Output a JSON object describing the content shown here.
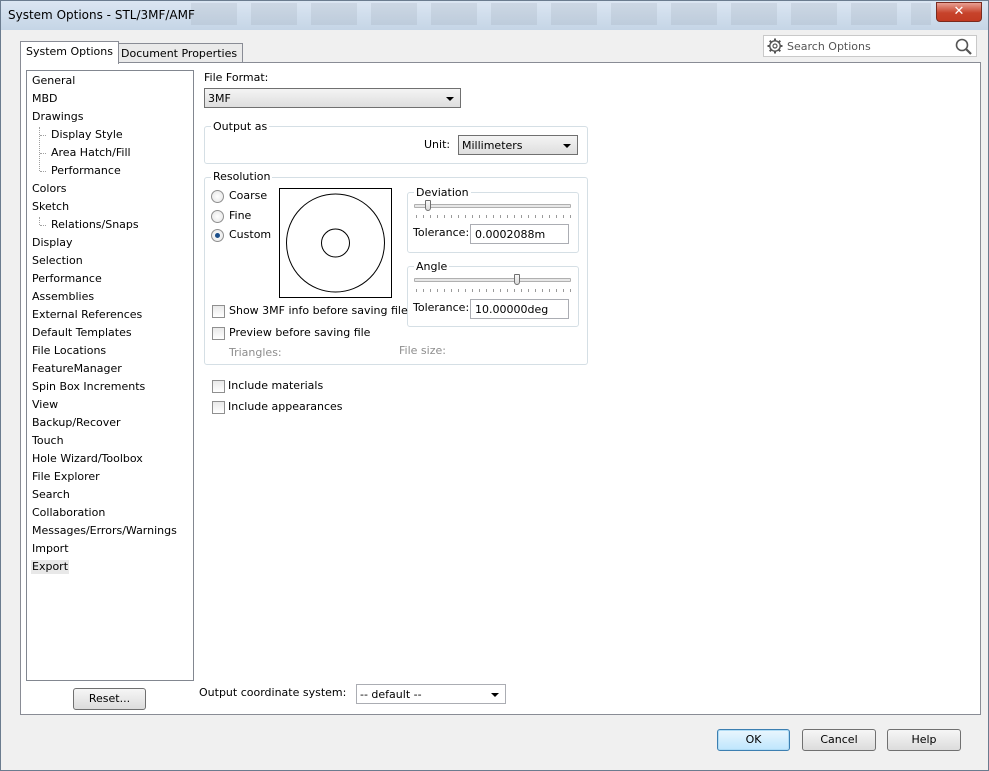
{
  "window": {
    "title": "System Options - STL/3MF/AMF",
    "close_glyph": "✕"
  },
  "tabs": [
    {
      "label": "System Options",
      "active": true
    },
    {
      "label": "Document Properties",
      "active": false
    }
  ],
  "search": {
    "placeholder": "Search Options",
    "icon_left": "gear-icon",
    "icon_right": "magnifier-icon"
  },
  "tree": {
    "items": [
      {
        "label": "General"
      },
      {
        "label": "MBD"
      },
      {
        "label": "Drawings"
      },
      {
        "label": "Display Style",
        "child": true
      },
      {
        "label": "Area Hatch/Fill",
        "child": true
      },
      {
        "label": "Performance",
        "child": true
      },
      {
        "label": "Colors"
      },
      {
        "label": "Sketch"
      },
      {
        "label": "Relations/Snaps",
        "child": true
      },
      {
        "label": "Display"
      },
      {
        "label": "Selection"
      },
      {
        "label": "Performance"
      },
      {
        "label": "Assemblies"
      },
      {
        "label": "External References"
      },
      {
        "label": "Default Templates"
      },
      {
        "label": "File Locations"
      },
      {
        "label": "FeatureManager"
      },
      {
        "label": "Spin Box Increments"
      },
      {
        "label": "View"
      },
      {
        "label": "Backup/Recover"
      },
      {
        "label": "Touch"
      },
      {
        "label": "Hole Wizard/Toolbox"
      },
      {
        "label": "File Explorer"
      },
      {
        "label": "Search"
      },
      {
        "label": "Collaboration"
      },
      {
        "label": "Messages/Errors/Warnings"
      },
      {
        "label": "Import"
      },
      {
        "label": "Export",
        "selected": true
      }
    ],
    "reset_label": "Reset..."
  },
  "export": {
    "file_format_label": "File Format:",
    "file_format_value": "3MF",
    "output_as": {
      "title": "Output as",
      "unit_label": "Unit:",
      "unit_value": "Millimeters"
    },
    "resolution": {
      "title": "Resolution",
      "options": [
        {
          "label": "Coarse",
          "checked": false
        },
        {
          "label": "Fine",
          "checked": false
        },
        {
          "label": "Custom",
          "checked": true
        }
      ],
      "deviation": {
        "title": "Deviation",
        "tolerance_label": "Tolerance:",
        "tolerance_value": "0.0002088m",
        "slider_level": 0.07
      },
      "angle": {
        "title": "Angle",
        "tolerance_label": "Tolerance:",
        "tolerance_value": "10.00000deg",
        "slider_level": 0.66
      },
      "show_info_label": "Show 3MF info before saving file",
      "preview_label": "Preview before saving file",
      "triangles_label": "Triangles:",
      "file_size_label": "File size:"
    },
    "include_materials_label": "Include materials",
    "include_appearances_label": "Include appearances",
    "coord_system_label": "Output coordinate system:",
    "coord_system_value": "-- default --"
  },
  "footer": {
    "ok_label": "OK",
    "cancel_label": "Cancel",
    "help_label": "Help"
  }
}
